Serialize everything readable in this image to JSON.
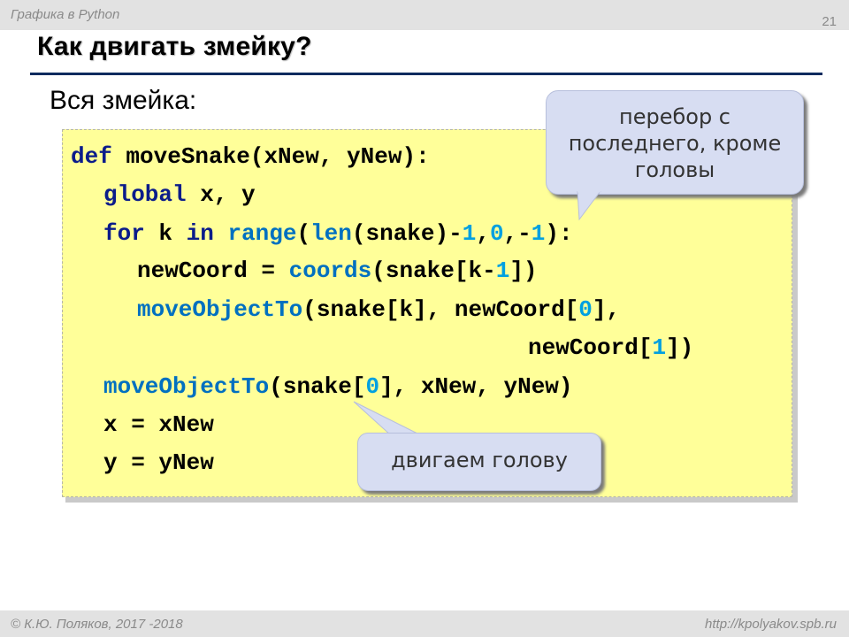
{
  "header": {
    "course": "Графика в Python",
    "page_number": "21"
  },
  "slide": {
    "title": "Как двигать змейку?",
    "subtitle": "Вся змейка:"
  },
  "code": {
    "line1": {
      "kw": "def",
      "rest": " moveSnake(xNew, yNew):"
    },
    "line2": {
      "kw": "global",
      "rest": " x, y"
    },
    "line3": {
      "kw_for": "for",
      "mid1": " k ",
      "kw_in": "in",
      "sp": " ",
      "fn_range": "range",
      "p1": "(",
      "fn_len": "len",
      "p2": "(snake)-",
      "n1": "1",
      "c1": ",",
      "n2": "0",
      "c2": ",-",
      "n3": "1",
      "p3": "):"
    },
    "line4": {
      "pre": "newCoord = ",
      "fn": "coords",
      "mid": "(snake[k-",
      "n": "1",
      "post": "])"
    },
    "line5": {
      "fn": "moveObjectTo",
      "mid": "(snake[k], newCoord[",
      "n": "0",
      "post": "],"
    },
    "line6": {
      "pre": "newCoord[",
      "n": "1",
      "post": "])"
    },
    "line7": {
      "fn": "moveObjectTo",
      "mid": "(snake[",
      "n": "0",
      "post": "], xNew, yNew)"
    },
    "line8": "x = xNew",
    "line9": "y = yNew"
  },
  "callouts": {
    "top": [
      "перебор с",
      "последнего, кроме",
      "головы"
    ],
    "bottom": "двигаем голову"
  },
  "footer": {
    "author": "© К.Ю. Поляков, 2017 -2018",
    "url": "http://kpolyakov.spb.ru"
  }
}
